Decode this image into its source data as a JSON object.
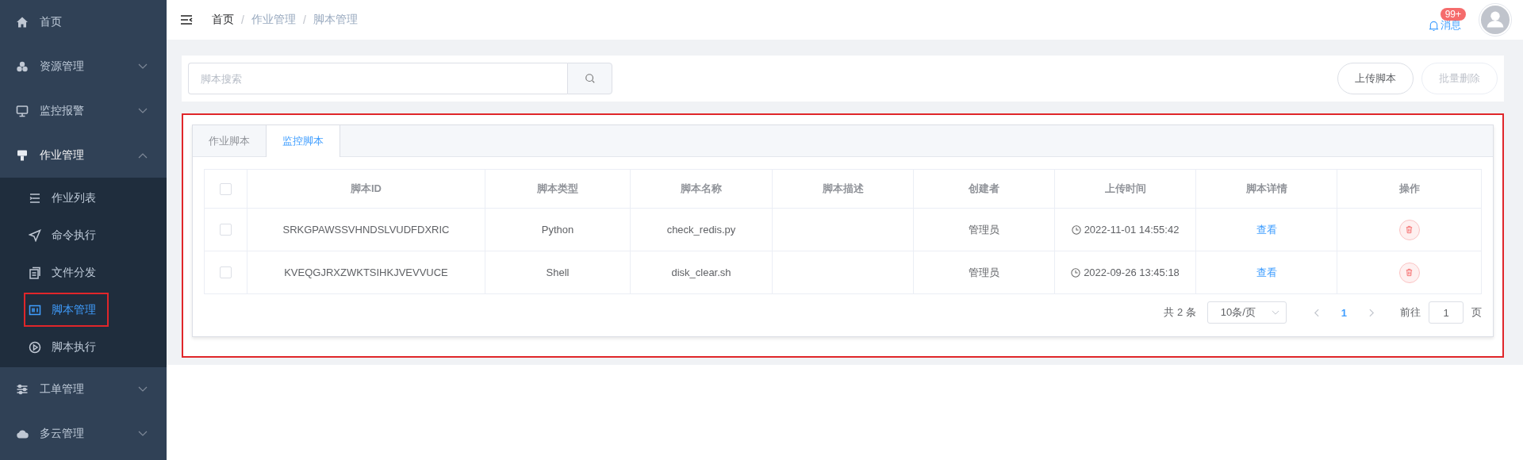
{
  "sidebar": {
    "items": [
      {
        "label": "首页",
        "expanded": false,
        "has_children": false
      },
      {
        "label": "资源管理",
        "expanded": false,
        "has_children": true
      },
      {
        "label": "监控报警",
        "expanded": false,
        "has_children": true
      },
      {
        "label": "作业管理",
        "expanded": true,
        "has_children": true,
        "children": [
          {
            "label": "作业列表",
            "selected": false,
            "highlighted": false
          },
          {
            "label": "命令执行",
            "selected": false,
            "highlighted": false
          },
          {
            "label": "文件分发",
            "selected": false,
            "highlighted": false
          },
          {
            "label": "脚本管理",
            "selected": true,
            "highlighted": true
          },
          {
            "label": "脚本执行",
            "selected": false,
            "highlighted": false
          }
        ]
      },
      {
        "label": "工单管理",
        "expanded": false,
        "has_children": true
      },
      {
        "label": "多云管理",
        "expanded": false,
        "has_children": true
      }
    ]
  },
  "breadcrumb": [
    {
      "kind": "link",
      "text": "首页"
    },
    {
      "kind": "separator",
      "text": "/"
    },
    {
      "kind": "link",
      "text": "作业管理"
    },
    {
      "kind": "separator",
      "text": "/"
    },
    {
      "kind": "link",
      "text": "脚本管理"
    }
  ],
  "header": {
    "messages_label": "消息",
    "badge": "99+"
  },
  "search": {
    "placeholder": "脚本搜索"
  },
  "actions": [
    {
      "label": "上传脚本",
      "disabled": false
    },
    {
      "label": "批量删除",
      "disabled": true
    }
  ],
  "panel": {
    "highlighted": true
  },
  "tabs": [
    {
      "label": "作业脚本",
      "selected": false
    },
    {
      "label": "监控脚本",
      "selected": true
    }
  ],
  "table": {
    "columns": [
      "脚本ID",
      "脚本类型",
      "脚本名称",
      "脚本描述",
      "创建者",
      "上传时间",
      "脚本详情",
      "操作"
    ],
    "header_checked": false,
    "rows": [
      {
        "checked": false,
        "id": "SRKGPAWSSVHNDSLVUDFDXRIC",
        "type": "Python",
        "name": "check_redis.py",
        "creator": "管理员",
        "time": "2022-11-01 14:55:42",
        "detail": "查看"
      },
      {
        "checked": false,
        "id": "KVEQGJRXZWKTSIHKJVEVVUCE",
        "type": "Shell",
        "name": "disk_clear.sh",
        "creator": "管理员",
        "time": "2022-09-26 13:45:18",
        "detail": "查看"
      }
    ]
  },
  "pagination": {
    "total": "共 2 条",
    "page_size": "10条/页",
    "pages": [
      {
        "label": "1",
        "selected": true
      }
    ],
    "goto_label": "前往",
    "goto_value": "1",
    "page_suffix": "页"
  }
}
